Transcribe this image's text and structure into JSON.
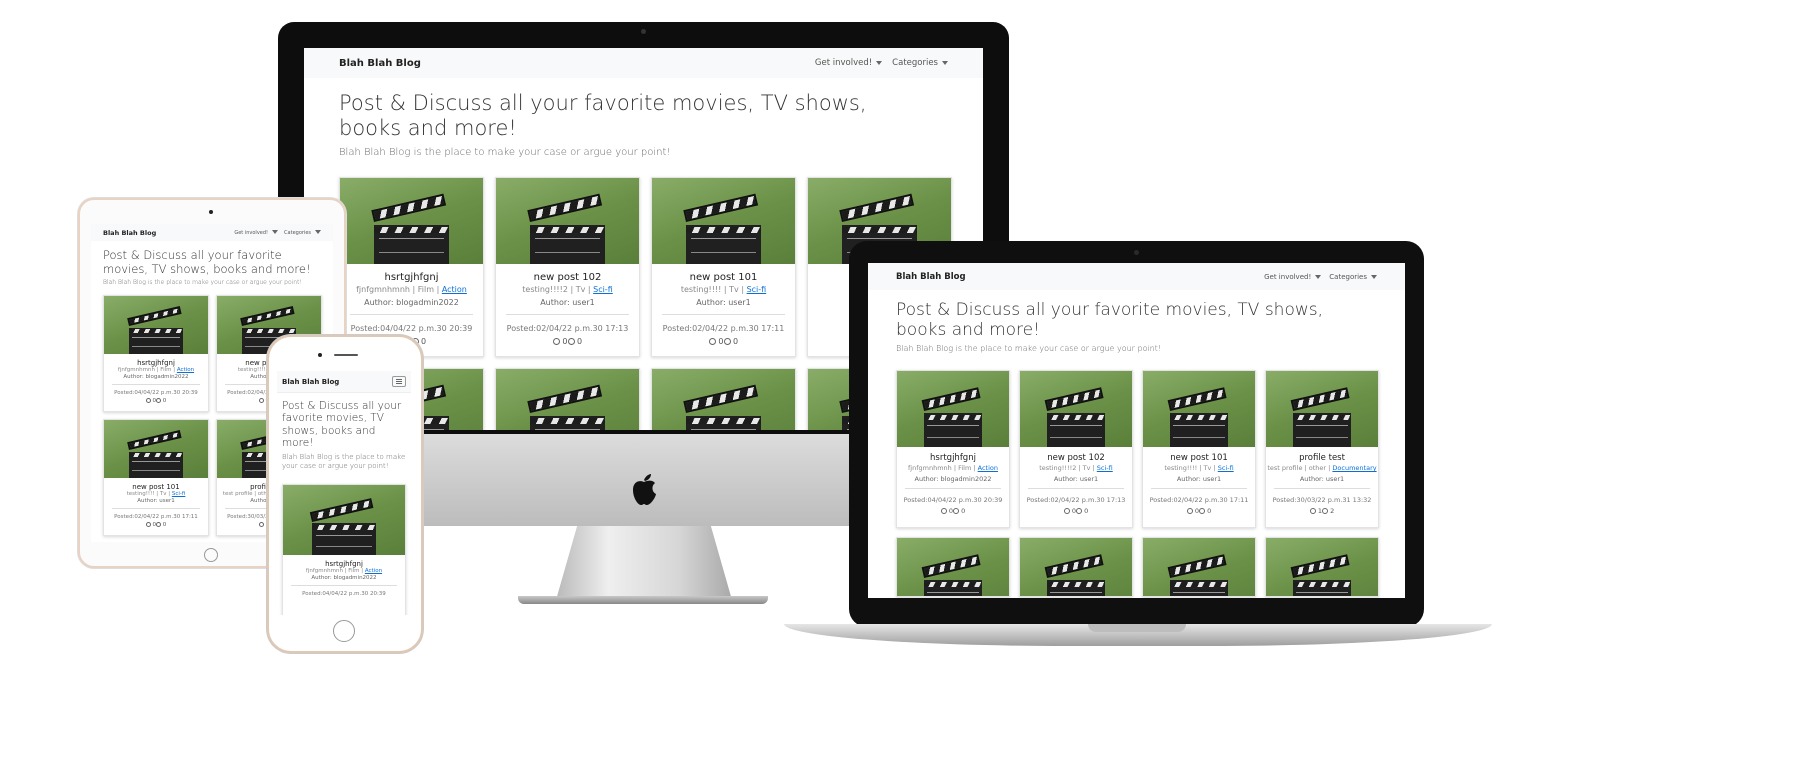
{
  "site": {
    "brand": "Blah Blah Blog",
    "nav_involved": "Get involved!",
    "nav_categories": "Categories",
    "hero_title": "Post & Discuss all your favorite movies, TV shows, books and more!",
    "hero_sub": "Blah Blah Blog is the place to make your case or argue your point!"
  },
  "posts": [
    {
      "title": "hsrtgjhfgnj",
      "desc": "fjnfgmnhmnh | Film | ",
      "cat": "Action",
      "author": "Author: blogadmin2022",
      "posted": "Posted:04/04/22 p.m.30 20:39",
      "likes": "0",
      "dislikes": "0"
    },
    {
      "title": "new post 102",
      "desc": "testing!!!!2 | Tv | ",
      "cat": "Sci-fi",
      "author": "Author: user1",
      "posted": "Posted:02/04/22 p.m.30 17:13",
      "likes": "0",
      "dislikes": "0"
    },
    {
      "title": "new post 101",
      "desc": "testing!!!! | Tv | ",
      "cat": "Sci-fi",
      "author": "Author: user1",
      "posted": "Posted:02/04/22 p.m.30 17:11",
      "likes": "0",
      "dislikes": "0"
    },
    {
      "title": "profile test",
      "desc": "test profile | other | ",
      "cat": "Documentary",
      "author": "Author: user1",
      "posted": "Posted:30/03/22 p.m.31 13:32",
      "likes": "1",
      "dislikes": "2"
    }
  ],
  "colors": {
    "accent": "#0b6fd8",
    "card_green": "#6b9148"
  }
}
